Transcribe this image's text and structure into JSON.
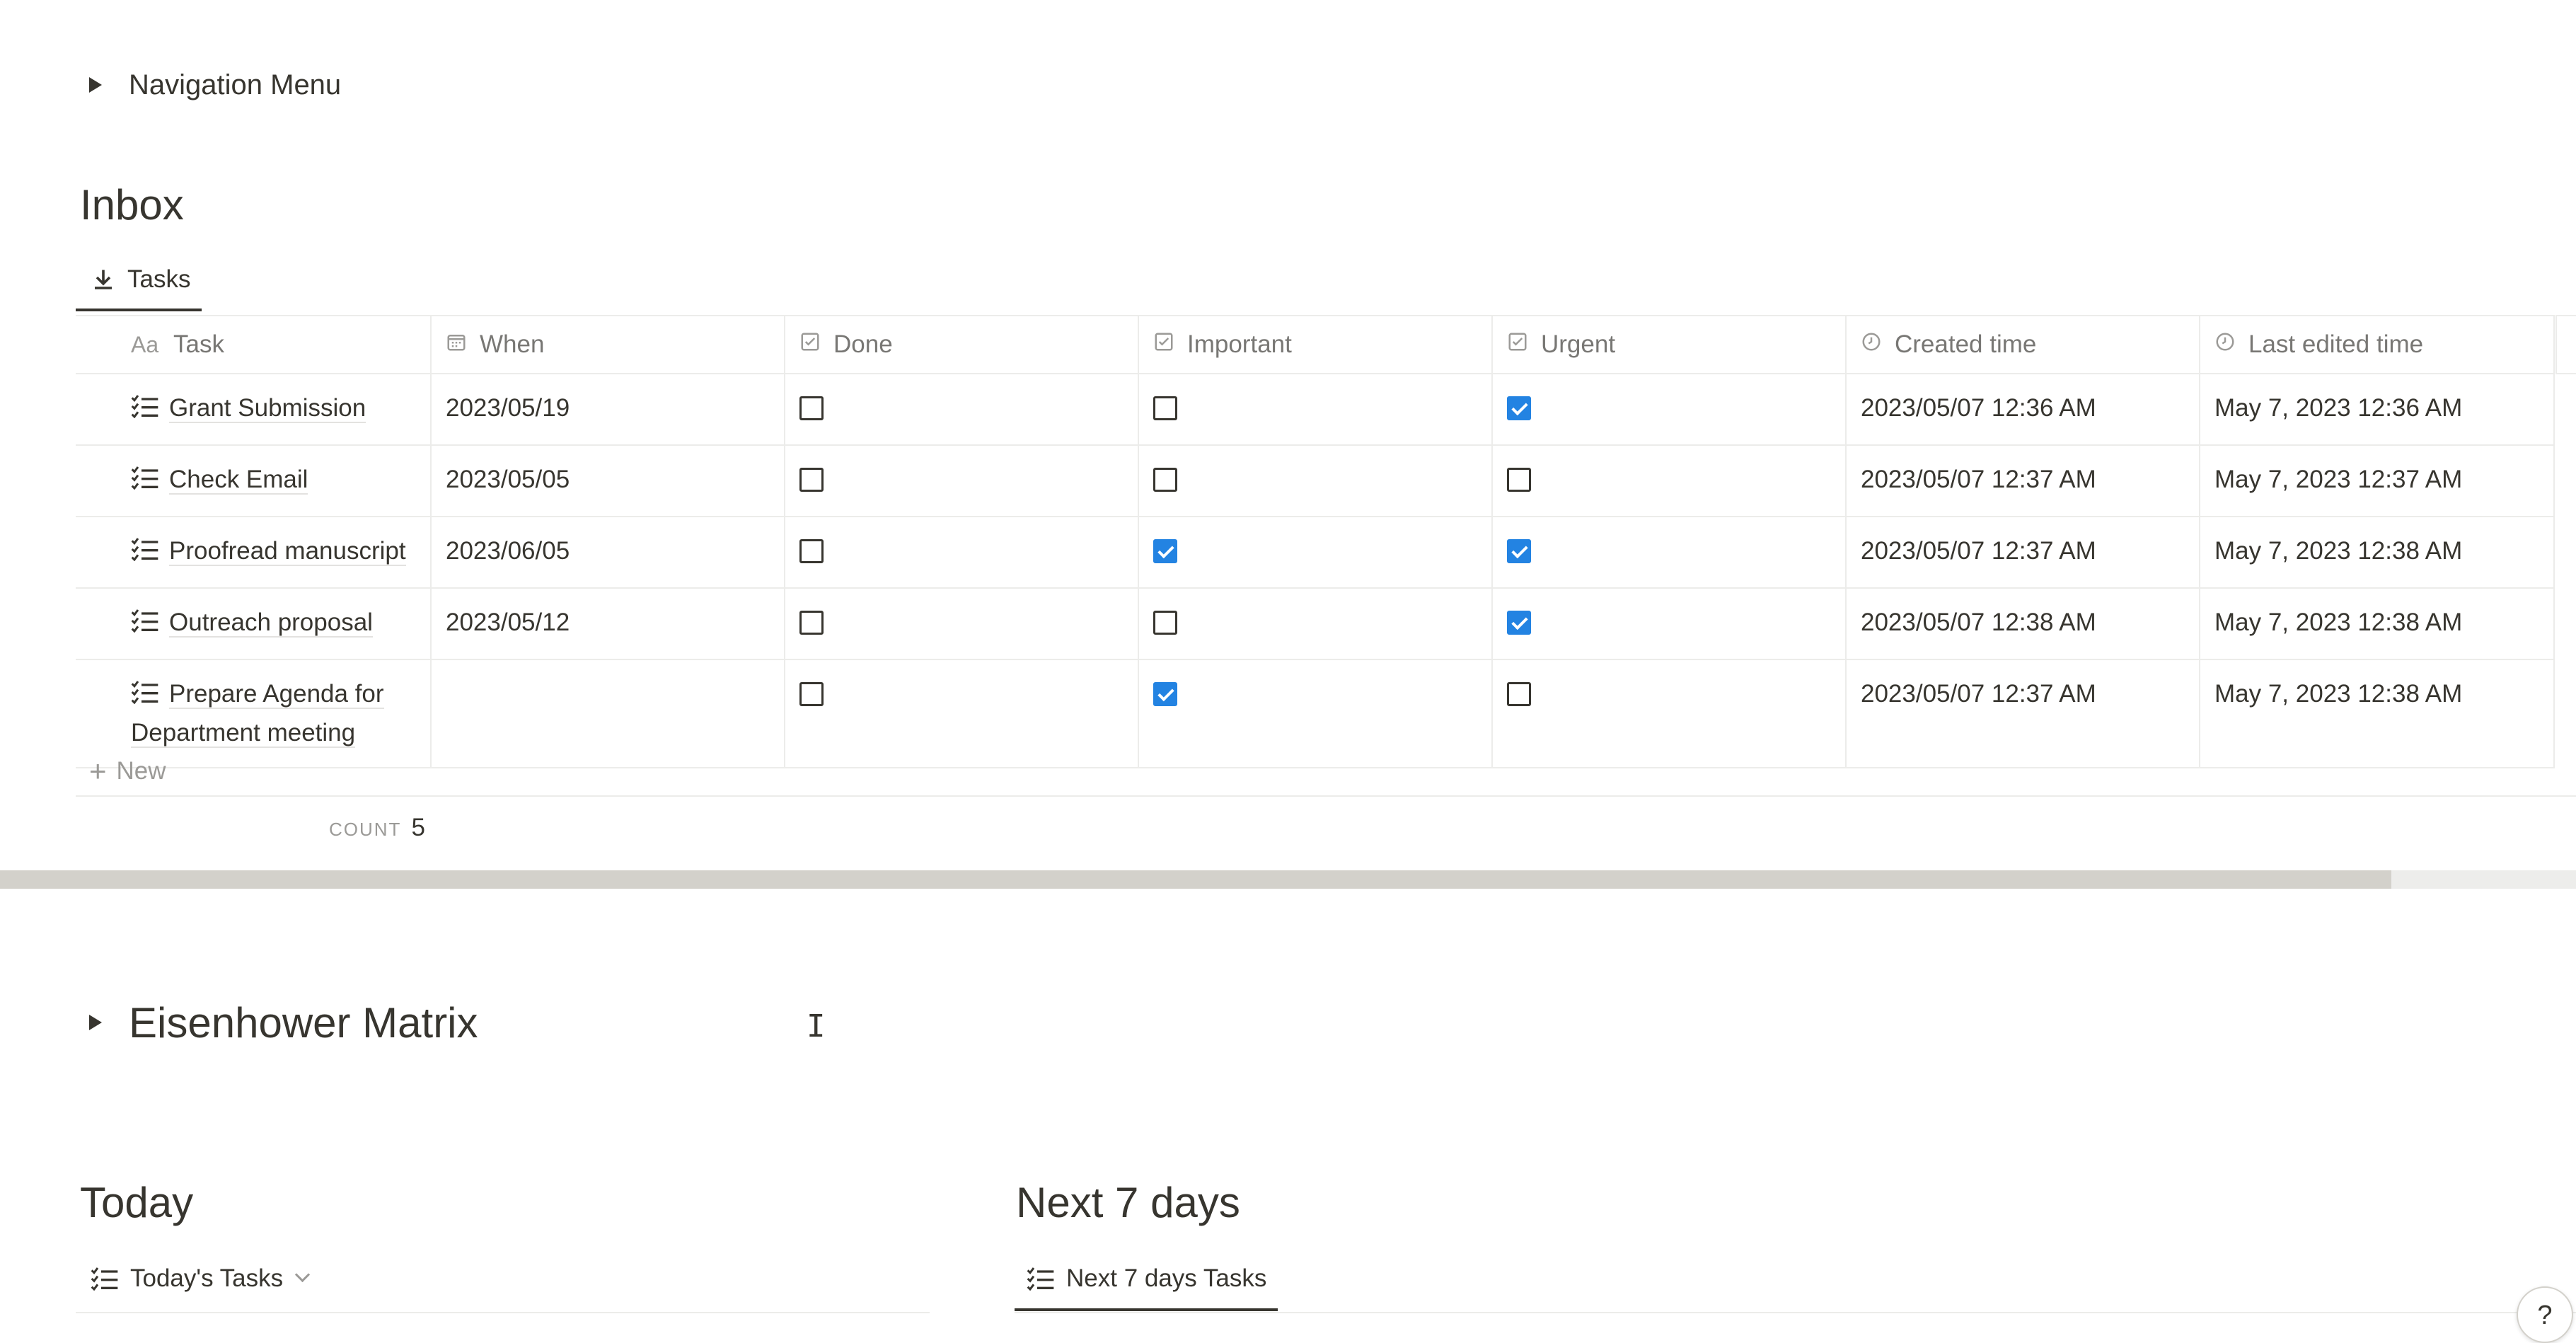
{
  "nav_toggle": {
    "label": "Navigation Menu"
  },
  "inbox": {
    "title": "Inbox",
    "view_tab": "Tasks",
    "columns": [
      {
        "icon": "title-icon",
        "label": "Task"
      },
      {
        "icon": "calendar-icon",
        "label": "When"
      },
      {
        "icon": "checkbox-icon",
        "label": "Done"
      },
      {
        "icon": "checkbox-icon",
        "label": "Important"
      },
      {
        "icon": "checkbox-icon",
        "label": "Urgent"
      },
      {
        "icon": "clock-icon",
        "label": "Created time"
      },
      {
        "icon": "clock-icon",
        "label": "Last edited time"
      }
    ],
    "rows": [
      {
        "task": "Grant Submission",
        "when": "2023/05/19",
        "done": false,
        "important": false,
        "urgent": true,
        "created": "2023/05/07 12:36 AM",
        "edited": "May 7, 2023 12:36 AM"
      },
      {
        "task": "Check Email",
        "when": "2023/05/05",
        "done": false,
        "important": false,
        "urgent": false,
        "created": "2023/05/07 12:37 AM",
        "edited": "May 7, 2023 12:37 AM"
      },
      {
        "task": "Proofread manuscript",
        "when": "2023/06/05",
        "done": false,
        "important": true,
        "urgent": true,
        "created": "2023/05/07 12:37 AM",
        "edited": "May 7, 2023 12:38 AM"
      },
      {
        "task": "Outreach proposal",
        "when": "2023/05/12",
        "done": false,
        "important": false,
        "urgent": true,
        "created": "2023/05/07 12:38 AM",
        "edited": "May 7, 2023 12:38 AM"
      },
      {
        "task": "Prepare Agenda for Department meeting",
        "when": "",
        "done": false,
        "important": true,
        "urgent": false,
        "created": "2023/05/07 12:37 AM",
        "edited": "May 7, 2023 12:38 AM"
      }
    ],
    "new_label": "New",
    "count_label": "COUNT",
    "count_value": "5"
  },
  "eisenhower": {
    "label": "Eisenhower Matrix"
  },
  "today": {
    "title": "Today",
    "view_tab": "Today's Tasks"
  },
  "next7": {
    "title": "Next 7 days",
    "view_tab": "Next 7 days Tasks"
  },
  "help": {
    "label": "?"
  },
  "colors": {
    "checkbox_checked": "#2383e2",
    "text": "#37352f",
    "muted": "#787774"
  }
}
